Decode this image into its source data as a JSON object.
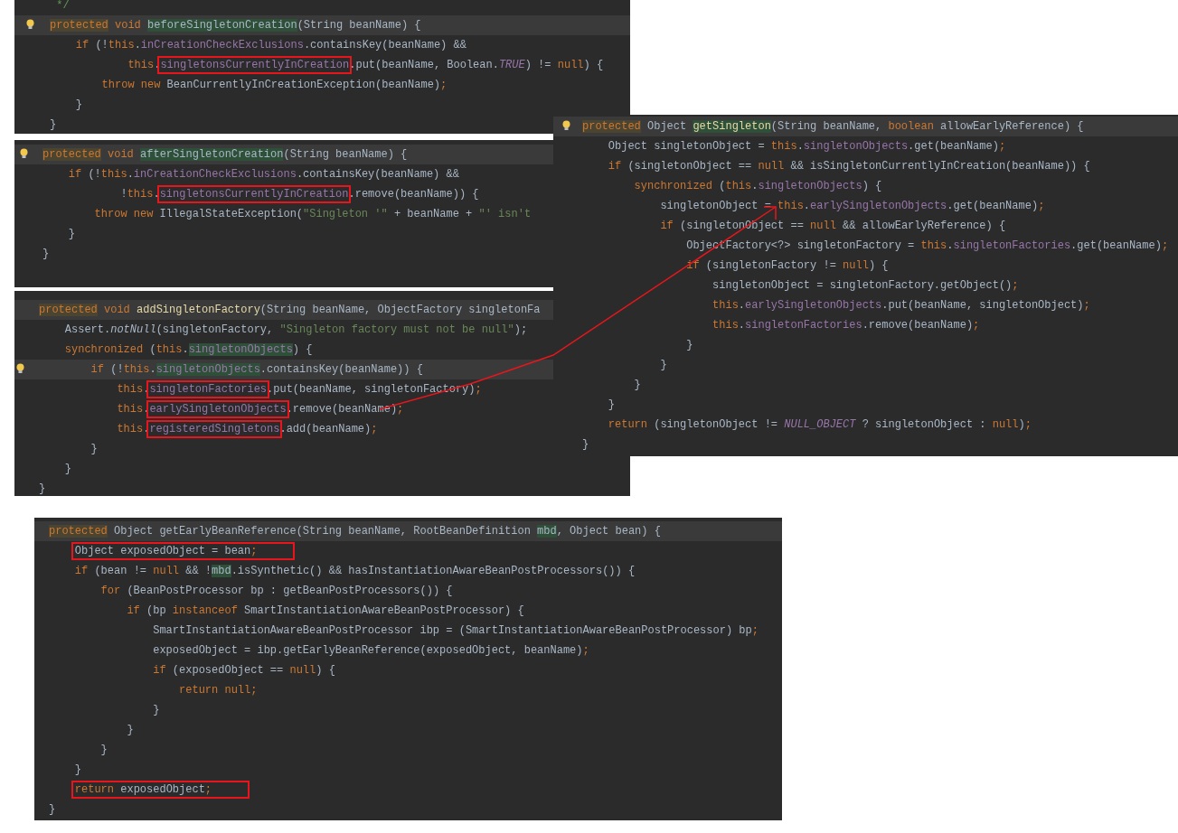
{
  "panels": [
    {
      "lines": [
        {
          "current": false,
          "tokens": [
            {
              "t": " */",
              "kind": "comment"
            }
          ]
        },
        {
          "current": true,
          "bulb": true,
          "tokens": [
            {
              "t": "protected",
              "kind": "keyword",
              "shaded": true
            },
            {
              "t": " void ",
              "kind": "keyword"
            },
            {
              "t": "beforeSingletonCreation",
              "kind": "plain",
              "shaded": true
            },
            {
              "t": "(String beanName) {",
              "kind": "plain"
            }
          ]
        },
        {
          "current": false,
          "tokens": [
            {
              "t": "    if",
              "kind": "keyword"
            },
            {
              "t": " (!",
              "kind": "plain"
            },
            {
              "t": "this",
              "kind": "keyword"
            },
            {
              "t": ".",
              "kind": "plain"
            },
            {
              "t": "inCreationCheckExclusions",
              "kind": "field"
            },
            {
              "t": ".containsKey(beanName) &&",
              "kind": "plain"
            }
          ]
        },
        {
          "current": false,
          "tokens": [
            {
              "t": "            this",
              "kind": "keyword"
            },
            {
              "t": ".",
              "kind": "plain"
            },
            {
              "t": "singletonsCurrentlyInCreation",
              "kind": "field",
              "boxed": true
            },
            {
              "t": ".put(beanName, Boolean.",
              "kind": "plain"
            },
            {
              "t": "TRUE",
              "kind": "constant"
            },
            {
              "t": ") != ",
              "kind": "plain"
            },
            {
              "t": "null",
              "kind": "keyword"
            },
            {
              "t": ") {",
              "kind": "plain"
            }
          ]
        },
        {
          "current": false,
          "tokens": [
            {
              "t": "        throw new",
              "kind": "keyword"
            },
            {
              "t": " BeanCurrentlyInCreationException(beanName)",
              "kind": "plain"
            },
            {
              "t": ";",
              "kind": "keyword"
            }
          ]
        },
        {
          "current": false,
          "tokens": [
            {
              "t": "    }",
              "kind": "plain"
            }
          ]
        },
        {
          "current": false,
          "tokens": [
            {
              "t": "}",
              "kind": "plain"
            }
          ]
        }
      ]
    },
    {
      "lines": [
        {
          "current": true,
          "bulb": true,
          "tokens": [
            {
              "t": "protected",
              "kind": "keyword",
              "shaded": true
            },
            {
              "t": " void ",
              "kind": "keyword"
            },
            {
              "t": "afterSingletonCreation",
              "kind": "plain",
              "shaded": true
            },
            {
              "t": "(String beanName) {",
              "kind": "plain"
            }
          ]
        },
        {
          "current": false,
          "tokens": [
            {
              "t": "    if",
              "kind": "keyword"
            },
            {
              "t": " (!",
              "kind": "plain"
            },
            {
              "t": "this",
              "kind": "keyword"
            },
            {
              "t": ".",
              "kind": "plain"
            },
            {
              "t": "inCreationCheckExclusions",
              "kind": "field"
            },
            {
              "t": ".containsKey(beanName) &&",
              "kind": "plain"
            }
          ]
        },
        {
          "current": false,
          "tokens": [
            {
              "t": "            !",
              "kind": "plain"
            },
            {
              "t": "this",
              "kind": "keyword"
            },
            {
              "t": ".",
              "kind": "plain"
            },
            {
              "t": "singletonsCurrentlyInCreation",
              "kind": "field",
              "boxed": true
            },
            {
              "t": ".remove(beanName)) {",
              "kind": "plain"
            }
          ]
        },
        {
          "current": false,
          "tokens": [
            {
              "t": "        throw new",
              "kind": "keyword"
            },
            {
              "t": " IllegalStateException(",
              "kind": "plain"
            },
            {
              "t": "\"Singleton '\"",
              "kind": "string"
            },
            {
              "t": " + beanName + ",
              "kind": "plain"
            },
            {
              "t": "\"' isn't",
              "kind": "string"
            }
          ]
        },
        {
          "current": false,
          "tokens": [
            {
              "t": "    }",
              "kind": "plain"
            }
          ]
        },
        {
          "current": false,
          "tokens": [
            {
              "t": "}",
              "kind": "plain"
            }
          ]
        }
      ]
    },
    {
      "lines": [
        {
          "current": true,
          "tokens": [
            {
              "t": "protected",
              "kind": "keyword",
              "shaded": true
            },
            {
              "t": " void ",
              "kind": "keyword"
            },
            {
              "t": "addSingletonFactory",
              "kind": "method"
            },
            {
              "t": "(String beanName, ObjectFactory singletonFa",
              "kind": "plain"
            }
          ]
        },
        {
          "current": false,
          "tokens": [
            {
              "t": "    Assert.",
              "kind": "plain"
            },
            {
              "t": "notNull",
              "kind": "static"
            },
            {
              "t": "(singletonFactory, ",
              "kind": "plain"
            },
            {
              "t": "\"Singleton factory must not be null\"",
              "kind": "string"
            },
            {
              "t": ");",
              "kind": "plain"
            }
          ]
        },
        {
          "current": false,
          "tokens": [
            {
              "t": "    synchronized",
              "kind": "keyword"
            },
            {
              "t": " (",
              "kind": "plain"
            },
            {
              "t": "this",
              "kind": "keyword"
            },
            {
              "t": ".",
              "kind": "plain"
            },
            {
              "t": "singletonObjects",
              "kind": "field",
              "shaded": true
            },
            {
              "t": ") {",
              "kind": "plain"
            }
          ]
        },
        {
          "current": true,
          "bulb": true,
          "tokens": [
            {
              "t": "        if",
              "kind": "keyword"
            },
            {
              "t": " (!",
              "kind": "plain"
            },
            {
              "t": "this",
              "kind": "keyword"
            },
            {
              "t": ".",
              "kind": "plain"
            },
            {
              "t": "singletonObjects",
              "kind": "field",
              "shaded": true
            },
            {
              "t": ".containsKey(beanName)) {",
              "kind": "plain"
            }
          ]
        },
        {
          "current": false,
          "tokens": [
            {
              "t": "            this",
              "kind": "keyword"
            },
            {
              "t": ".",
              "kind": "plain"
            },
            {
              "t": "singletonFactories",
              "kind": "field",
              "boxed": true
            },
            {
              "t": ".put(beanName, singletonFactory)",
              "kind": "plain"
            },
            {
              "t": ";",
              "kind": "keyword"
            }
          ]
        },
        {
          "current": false,
          "tokens": [
            {
              "t": "            this",
              "kind": "keyword"
            },
            {
              "t": ".",
              "kind": "plain"
            },
            {
              "t": "earlySingletonObjects",
              "kind": "field",
              "boxed": true
            },
            {
              "t": ".remove(beanName)",
              "kind": "plain"
            },
            {
              "t": ";",
              "kind": "keyword"
            }
          ]
        },
        {
          "current": false,
          "tokens": [
            {
              "t": "            this",
              "kind": "keyword"
            },
            {
              "t": ".",
              "kind": "plain"
            },
            {
              "t": "registeredSingletons",
              "kind": "field",
              "boxed": true
            },
            {
              "t": ".add(beanName)",
              "kind": "plain"
            },
            {
              "t": ";",
              "kind": "keyword"
            }
          ]
        },
        {
          "current": false,
          "tokens": [
            {
              "t": "        }",
              "kind": "plain"
            }
          ]
        },
        {
          "current": false,
          "tokens": [
            {
              "t": "    }",
              "kind": "plain"
            }
          ]
        },
        {
          "current": false,
          "tokens": [
            {
              "t": "}",
              "kind": "plain"
            }
          ]
        }
      ]
    },
    {
      "lines": [
        {
          "current": true,
          "bulb": true,
          "tokens": [
            {
              "t": "protected",
              "kind": "keyword",
              "shaded": true
            },
            {
              "t": " Object ",
              "kind": "plain"
            },
            {
              "t": "getSingleton",
              "kind": "method",
              "shaded": true
            },
            {
              "t": "(String beanName, ",
              "kind": "plain"
            },
            {
              "t": "boolean",
              "kind": "keyword"
            },
            {
              "t": " allowEarlyReference) {",
              "kind": "plain"
            }
          ]
        },
        {
          "current": false,
          "tokens": [
            {
              "t": "    Object singletonObject = ",
              "kind": "plain"
            },
            {
              "t": "this",
              "kind": "keyword"
            },
            {
              "t": ".",
              "kind": "plain"
            },
            {
              "t": "singletonObjects",
              "kind": "field"
            },
            {
              "t": ".get(beanName)",
              "kind": "plain"
            },
            {
              "t": ";",
              "kind": "keyword"
            }
          ]
        },
        {
          "current": false,
          "tokens": [
            {
              "t": "    if",
              "kind": "keyword"
            },
            {
              "t": " (singletonObject == ",
              "kind": "plain"
            },
            {
              "t": "null",
              "kind": "keyword"
            },
            {
              "t": " && isSingletonCurrentlyInCreation(beanName)) {",
              "kind": "plain"
            }
          ]
        },
        {
          "current": false,
          "tokens": [
            {
              "t": "        synchronized",
              "kind": "keyword"
            },
            {
              "t": " (",
              "kind": "plain"
            },
            {
              "t": "this",
              "kind": "keyword"
            },
            {
              "t": ".",
              "kind": "plain"
            },
            {
              "t": "singletonObjects",
              "kind": "field"
            },
            {
              "t": ") {",
              "kind": "plain"
            }
          ]
        },
        {
          "current": false,
          "tokens": [
            {
              "t": "            singletonObject = ",
              "kind": "plain"
            },
            {
              "t": "this",
              "kind": "keyword"
            },
            {
              "t": ".",
              "kind": "plain"
            },
            {
              "t": "earlySingletonObjects",
              "kind": "field"
            },
            {
              "t": ".get(beanName)",
              "kind": "plain"
            },
            {
              "t": ";",
              "kind": "keyword"
            }
          ]
        },
        {
          "current": false,
          "tokens": [
            {
              "t": "            if",
              "kind": "keyword"
            },
            {
              "t": " (singletonObject == ",
              "kind": "plain"
            },
            {
              "t": "null",
              "kind": "keyword"
            },
            {
              "t": " && allowEarlyReference) {",
              "kind": "plain"
            }
          ]
        },
        {
          "current": false,
          "tokens": [
            {
              "t": "                ObjectFactory<?> singletonFactory = ",
              "kind": "plain"
            },
            {
              "t": "this",
              "kind": "keyword"
            },
            {
              "t": ".",
              "kind": "plain"
            },
            {
              "t": "singletonFactories",
              "kind": "field"
            },
            {
              "t": ".get(beanName)",
              "kind": "plain"
            },
            {
              "t": ";",
              "kind": "keyword"
            }
          ]
        },
        {
          "current": false,
          "tokens": [
            {
              "t": "                if",
              "kind": "keyword"
            },
            {
              "t": " (singletonFactory != ",
              "kind": "plain"
            },
            {
              "t": "null",
              "kind": "keyword"
            },
            {
              "t": ") {",
              "kind": "plain"
            }
          ]
        },
        {
          "current": false,
          "tokens": [
            {
              "t": "                    singletonObject = singletonFactory.getObject()",
              "kind": "plain"
            },
            {
              "t": ";",
              "kind": "keyword"
            }
          ]
        },
        {
          "current": false,
          "tokens": [
            {
              "t": "                    this",
              "kind": "keyword"
            },
            {
              "t": ".",
              "kind": "plain"
            },
            {
              "t": "earlySingletonObjects",
              "kind": "field"
            },
            {
              "t": ".put(beanName, singletonObject)",
              "kind": "plain"
            },
            {
              "t": ";",
              "kind": "keyword"
            }
          ]
        },
        {
          "current": false,
          "tokens": [
            {
              "t": "                    this",
              "kind": "keyword"
            },
            {
              "t": ".",
              "kind": "plain"
            },
            {
              "t": "singletonFactories",
              "kind": "field"
            },
            {
              "t": ".remove(beanName)",
              "kind": "plain"
            },
            {
              "t": ";",
              "kind": "keyword"
            }
          ]
        },
        {
          "current": false,
          "tokens": [
            {
              "t": "                }",
              "kind": "plain"
            }
          ]
        },
        {
          "current": false,
          "tokens": [
            {
              "t": "            }",
              "kind": "plain"
            }
          ]
        },
        {
          "current": false,
          "tokens": [
            {
              "t": "        }",
              "kind": "plain"
            }
          ]
        },
        {
          "current": false,
          "tokens": [
            {
              "t": "    }",
              "kind": "plain"
            }
          ]
        },
        {
          "current": false,
          "tokens": [
            {
              "t": "    return",
              "kind": "keyword"
            },
            {
              "t": " (singletonObject != ",
              "kind": "plain"
            },
            {
              "t": "NULL_OBJECT",
              "kind": "constant"
            },
            {
              "t": " ? singletonObject : ",
              "kind": "plain"
            },
            {
              "t": "null",
              "kind": "keyword"
            },
            {
              "t": ")",
              "kind": "plain"
            },
            {
              "t": ";",
              "kind": "keyword"
            }
          ]
        },
        {
          "current": false,
          "tokens": [
            {
              "t": "}",
              "kind": "plain"
            }
          ]
        }
      ]
    },
    {
      "lines": [
        {
          "current": true,
          "tokens": [
            {
              "t": "protected",
              "kind": "keyword",
              "shaded": true
            },
            {
              "t": " Object getEarlyBeanReference(String beanName, RootBeanDefinition ",
              "kind": "plain"
            },
            {
              "t": "mbd",
              "kind": "plain",
              "shaded": true
            },
            {
              "t": ", Object bean) {",
              "kind": "plain"
            }
          ]
        },
        {
          "current": false,
          "boxed": true,
          "tokens": [
            {
              "t": "    Object exposedObject = bean",
              "kind": "plain"
            },
            {
              "t": ";",
              "kind": "keyword"
            }
          ]
        },
        {
          "current": false,
          "tokens": [
            {
              "t": "    if",
              "kind": "keyword"
            },
            {
              "t": " (bean != ",
              "kind": "plain"
            },
            {
              "t": "null",
              "kind": "keyword"
            },
            {
              "t": " && !",
              "kind": "plain"
            },
            {
              "t": "mbd",
              "kind": "plain",
              "shaded": true
            },
            {
              "t": ".isSynthetic() && hasInstantiationAwareBeanPostProcessors()) {",
              "kind": "plain"
            }
          ]
        },
        {
          "current": false,
          "tokens": [
            {
              "t": "        for",
              "kind": "keyword"
            },
            {
              "t": " (BeanPostProcessor bp : getBeanPostProcessors()) {",
              "kind": "plain"
            }
          ]
        },
        {
          "current": false,
          "tokens": [
            {
              "t": "            if",
              "kind": "keyword"
            },
            {
              "t": " (bp ",
              "kind": "plain"
            },
            {
              "t": "instanceof",
              "kind": "keyword"
            },
            {
              "t": " SmartInstantiationAwareBeanPostProcessor) {",
              "kind": "plain"
            }
          ]
        },
        {
          "current": false,
          "tokens": [
            {
              "t": "                SmartInstantiationAwareBeanPostProcessor ibp = (SmartInstantiationAwareBeanPostProcessor) bp",
              "kind": "plain"
            },
            {
              "t": ";",
              "kind": "keyword"
            }
          ]
        },
        {
          "current": false,
          "tokens": [
            {
              "t": "                exposedObject = ibp.getEarlyBeanReference(exposedObject, beanName)",
              "kind": "plain"
            },
            {
              "t": ";",
              "kind": "keyword"
            }
          ]
        },
        {
          "current": false,
          "tokens": [
            {
              "t": "                if",
              "kind": "keyword"
            },
            {
              "t": " (exposedObject == ",
              "kind": "plain"
            },
            {
              "t": "null",
              "kind": "keyword"
            },
            {
              "t": ") {",
              "kind": "plain"
            }
          ]
        },
        {
          "current": false,
          "tokens": [
            {
              "t": "                    return null;",
              "kind": "keyword"
            }
          ]
        },
        {
          "current": false,
          "tokens": [
            {
              "t": "                }",
              "kind": "plain"
            }
          ]
        },
        {
          "current": false,
          "tokens": [
            {
              "t": "            }",
              "kind": "plain"
            }
          ]
        },
        {
          "current": false,
          "tokens": [
            {
              "t": "        }",
              "kind": "plain"
            }
          ]
        },
        {
          "current": false,
          "tokens": [
            {
              "t": "    }",
              "kind": "plain"
            }
          ]
        },
        {
          "current": false,
          "boxed": true,
          "tokens": [
            {
              "t": "    return",
              "kind": "keyword"
            },
            {
              "t": " exposedObject",
              "kind": "plain"
            },
            {
              "t": ";",
              "kind": "keyword"
            }
          ]
        },
        {
          "current": false,
          "tokens": [
            {
              "t": "}",
              "kind": "plain"
            }
          ]
        }
      ]
    }
  ]
}
